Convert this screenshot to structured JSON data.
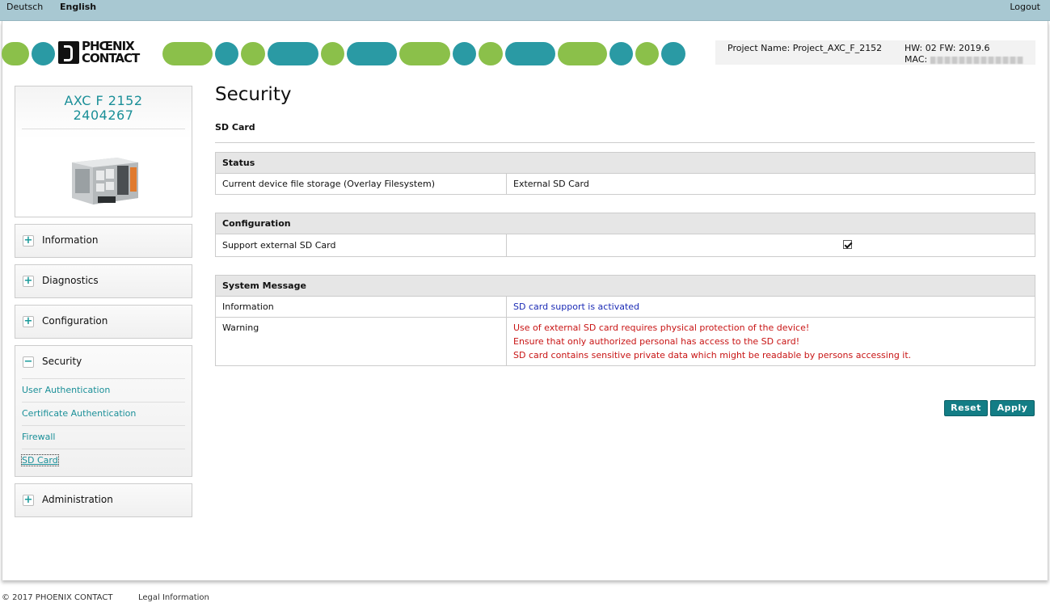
{
  "topbar": {
    "lang_de": "Deutsch",
    "lang_en": "English",
    "logout": "Logout"
  },
  "header": {
    "logo_line1": "PHŒNIX",
    "logo_line2": "CONTACT",
    "project_name": "Project Name: Project_AXC_F_2152",
    "hw_fw": "HW: 02 FW: 2019.6",
    "mac_label": "MAC:"
  },
  "device": {
    "model": "AXC F 2152",
    "part_number": "2404267"
  },
  "sidebar": {
    "information": "Information",
    "diagnostics": "Diagnostics",
    "configuration": "Configuration",
    "security": "Security",
    "administration": "Administration",
    "plus": "+",
    "minus": "−",
    "security_items": [
      {
        "label": "User Authentication"
      },
      {
        "label": "Certificate Authentication"
      },
      {
        "label": "Firewall"
      },
      {
        "label": "SD Card"
      }
    ]
  },
  "main": {
    "title": "Security",
    "subtitle": "SD Card",
    "status": {
      "header": "Status",
      "row_label": "Current device file storage (Overlay Filesystem)",
      "row_value": "External SD Card"
    },
    "configuration": {
      "header": "Configuration",
      "row_label": "Support external SD Card",
      "checked": true
    },
    "system_message": {
      "header": "System Message",
      "info_label": "Information",
      "info_value": "SD card support is activated",
      "warning_label": "Warning",
      "warning_lines": [
        "Use of external SD card requires physical protection of the device!",
        "Ensure that only authorized personal has access to the SD card!",
        "SD card contains sensitive private data which might be readable by persons accessing it."
      ]
    },
    "reset_label": "Reset",
    "apply_label": "Apply"
  },
  "footer": {
    "copyright": "© 2017 PHOENIX CONTACT",
    "legal": "Legal Information"
  },
  "colors": {
    "teal": "#2a9aa4",
    "green": "#8bc04a",
    "button": "#137d85",
    "link": "#1a8f98",
    "warning": "#c81414",
    "info": "#1b2bb5"
  }
}
